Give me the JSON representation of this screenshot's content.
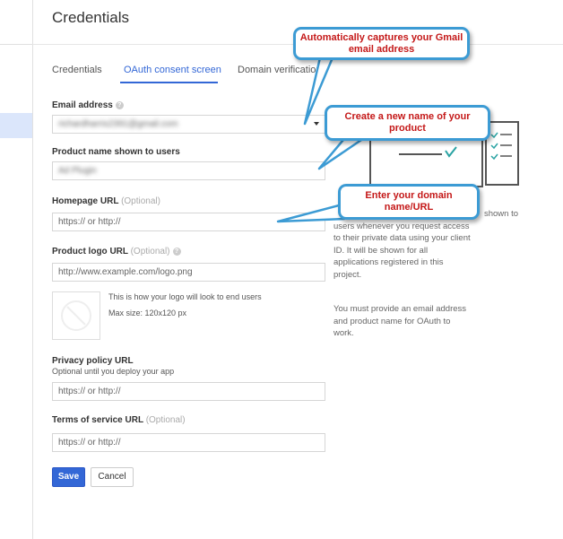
{
  "page": {
    "title": "Credentials"
  },
  "tabs": [
    "Credentials",
    "OAuth consent screen",
    "Domain verification"
  ],
  "form": {
    "email_label": "Email address",
    "email_value": "richardharris2391@gmail.com",
    "product_label": "Product name shown to users",
    "product_value": "Ad Plugin",
    "homepage_label": "Homepage URL",
    "homepage_optional": "(Optional)",
    "homepage_placeholder": "https:// or http://",
    "logo_label": "Product logo URL",
    "logo_optional": "(Optional)",
    "logo_placeholder": "http://www.example.com/logo.png",
    "logo_hint_1": "This is how your logo will look to end users",
    "logo_hint_2": "Max size: 120x120 px",
    "privacy_label": "Privacy policy URL",
    "privacy_sub": "Optional until you deploy your app",
    "privacy_placeholder": "https:// or http://",
    "terms_label": "Terms of service URL",
    "terms_optional": "(Optional)",
    "terms_placeholder": "https:// or http://"
  },
  "buttons": {
    "save": "Save",
    "cancel": "Cancel"
  },
  "right_panel": {
    "frag1": "shown to",
    "frag2": "users whenever you request access",
    "frag3": "to their private data using your client",
    "frag4": "ID. It will be shown for all",
    "frag5": "applications registered in this",
    "frag6": "project.",
    "note1": "You must provide an email address",
    "note2": "and product name for OAuth to",
    "note3": "work."
  },
  "callouts": {
    "email": "Automatically captures your Gmail email address",
    "product": "Create a new name of your product",
    "domain": "Enter your domain name/URL"
  },
  "colors": {
    "accent": "#3367d6",
    "callout_border": "#3c9bd4",
    "callout_text": "#c41818"
  }
}
